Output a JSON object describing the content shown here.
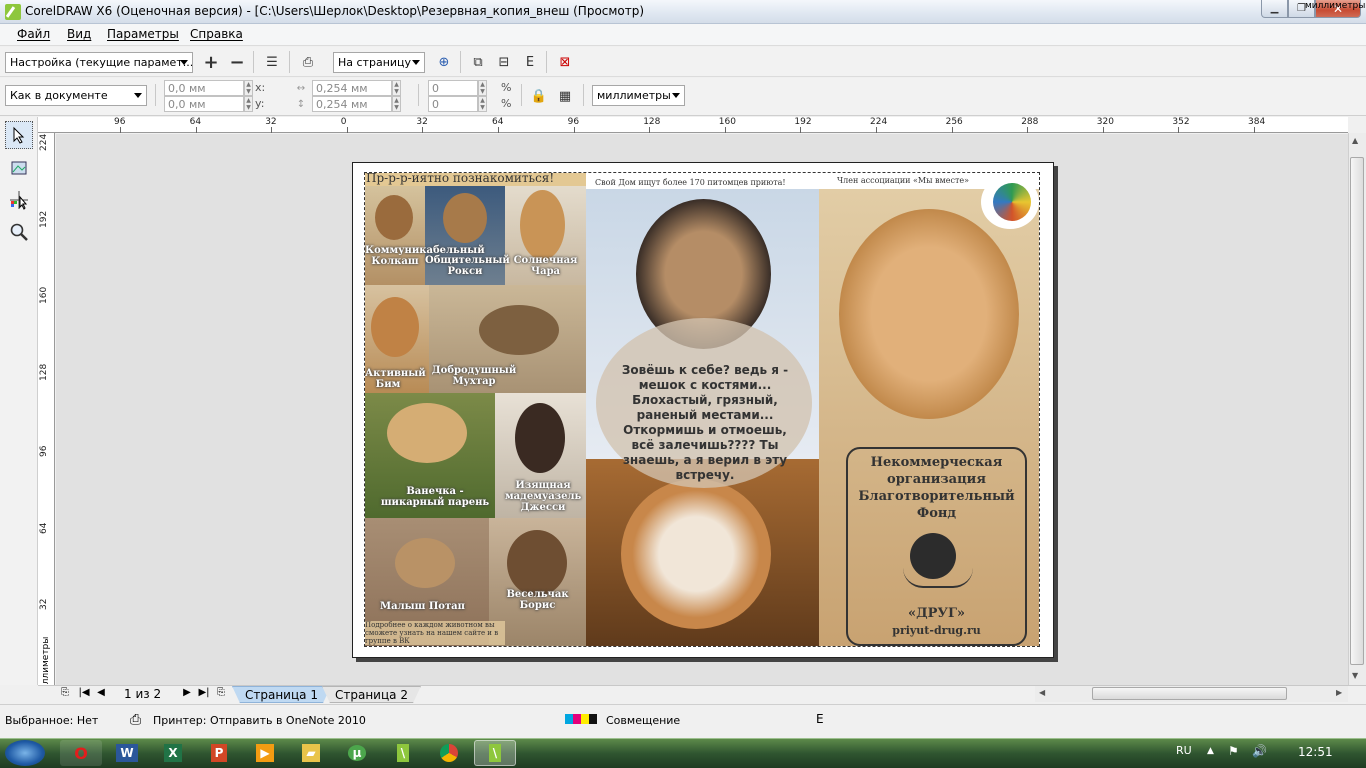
{
  "window": {
    "title": "CorelDRAW X6 (Оценочная версия) - [C:\\Users\\Шерлок\\Desktop\\Резервная_копия_внеш (Просмотр)",
    "min_label": "▁",
    "max_label": "❐",
    "close_label": "✕"
  },
  "menu": {
    "items": [
      "Файл",
      "Вид",
      "Параметры",
      "Справка"
    ]
  },
  "toolbar1": {
    "preset": "Настройка (текущие парамет...",
    "view_mode": "На страницу"
  },
  "toolbar2": {
    "doc_mode": "Как в документе",
    "pos_x": "0,0 мм",
    "pos_y": "0,0 мм",
    "x_label": "x:",
    "y_label": "y:",
    "size_w": "0,254 мм",
    "size_h": "0,254 мм",
    "scale_w": "0",
    "scale_h": "0",
    "pct": "%",
    "units": "миллиметры"
  },
  "ruler": {
    "h_labels": [
      "96",
      "64",
      "32",
      "0",
      "32",
      "64",
      "96",
      "128",
      "160",
      "192",
      "224",
      "256",
      "288",
      "320",
      "352",
      "384"
    ],
    "v_labels": [
      "224",
      "192",
      "160",
      "128",
      "96",
      "64",
      "32"
    ],
    "unit": "миллиметры"
  },
  "flyer": {
    "headline": "Пр-р-р-иятно познакомиться!",
    "top_note": "Свой Дом ищут более 170 питомцев приюта!",
    "member": "Член ассоциации «Мы вместе»",
    "poem": "Зовёшь к себе? ведь я - мешок с костями... Блохастый, грязный, раненый местами... Откормишь и отмоешь, всё залечишь???? Ты знаешь, а я верил в эту встречу.",
    "org_line1": "Некоммерческая",
    "org_line2": "организация",
    "org_line3": "Благотворительный",
    "org_line4": "Фонд",
    "org_name": "«ДРУГ»",
    "org_site": "priyut-drug.ru",
    "footer_note": "Подробнее о каждом животном вы сможете узнать на нашем сайте и в группе в ВК",
    "captions": {
      "c1": "Общительный Рокси",
      "c2": "Солнечная Чара",
      "c3": "Добродушный Мухтар",
      "c4": "Активный Бим",
      "c5": "Ванечка - шикарный парень",
      "c6": "Изящная мадемуазель Джесси",
      "c7": "Малыш Потап",
      "c8": "Весельчак Борис",
      "c9": "Коммуникабельный Колкаш"
    }
  },
  "pages": {
    "counter": "1 из 2",
    "tab1": "Страница 1",
    "tab2": "Страница 2"
  },
  "status": {
    "selection": "Выбранное: Нет",
    "printer": "Принтер: Отправить в OneNote 2010",
    "overprint": "Совмещение"
  },
  "taskbar": {
    "lang": "RU",
    "clock": "12:51"
  },
  "colors": {
    "accent": "#8ec73d",
    "tab_active": "#bfd9f2"
  }
}
